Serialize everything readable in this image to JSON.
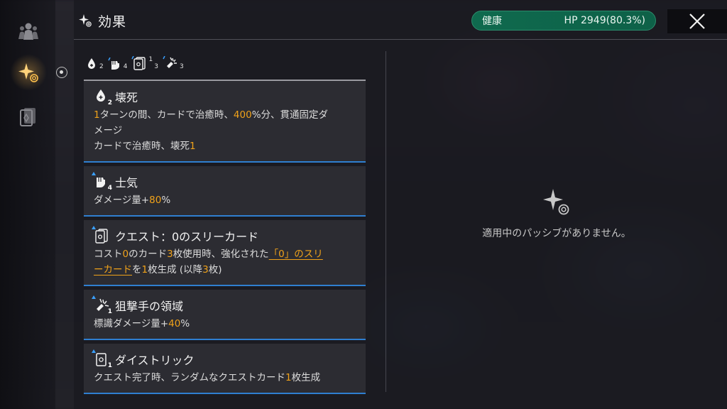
{
  "header": {
    "title": "効果",
    "status_label": "健康",
    "hp_text": "HP 2949(80.3%)",
    "status_color": "#0f6a4e"
  },
  "sidebar": {
    "items": [
      {
        "icon": "party-icon",
        "active": false
      },
      {
        "icon": "sparkle-effect-icon",
        "active": true
      },
      {
        "icon": "card-deck-icon",
        "active": false
      }
    ]
  },
  "summary": [
    {
      "icon": "decay-icon",
      "count": "2",
      "buff": false
    },
    {
      "icon": "morale-fist-icon",
      "count": "4",
      "buff": true
    },
    {
      "icon": "quest-card-icon",
      "count": "3",
      "sub": "1",
      "buff": true
    },
    {
      "icon": "sniper-icon",
      "count": "3",
      "buff": true
    }
  ],
  "effects": [
    {
      "name": "壊死",
      "icon": "decay-icon",
      "count": "2",
      "desc": {
        "l1a": "1",
        "l1b": "ターンの間、カードで治癒時、",
        "l1c": "400",
        "l1d": "%分、貫通固定ダ",
        "l2": "メージ",
        "l3a": "カードで治癒時、壊死",
        "l3b": "1"
      }
    },
    {
      "name": "士気",
      "icon": "morale-fist-icon",
      "count": "4",
      "desc": {
        "a": "ダメージ量+",
        "b": "80",
        "c": "%"
      }
    },
    {
      "name": "クエスト：0のスリーカード",
      "icon": "quest-card-icon",
      "count": "",
      "desc": {
        "a": "コスト",
        "b": "0",
        "c": "のカード",
        "d": "3",
        "e": "枚使用時、強化された",
        "link1": "「0」のスリ",
        "link2": "ーカード",
        "f": "を",
        "g": "1",
        "h": "枚生成 (以降",
        "i": "3",
        "j": "枚)"
      }
    },
    {
      "name": "狙撃手の領域",
      "icon": "sniper-icon",
      "count": "1",
      "desc": {
        "a": "標識ダメージ量+",
        "b": "40",
        "c": "%"
      }
    },
    {
      "name": "ダイストリック",
      "icon": "dice-card-icon",
      "count": "1",
      "desc": {
        "a": "クエスト完了時、ランダムなクエストカード",
        "b": "1",
        "c": "枚生成"
      }
    }
  ],
  "passive": {
    "empty_text": "適用中のパッシブがありません。",
    "icon": "sparkle-effect-icon"
  },
  "colors": {
    "accent": "#f0a21a",
    "card_border": "#2f7fd0"
  }
}
